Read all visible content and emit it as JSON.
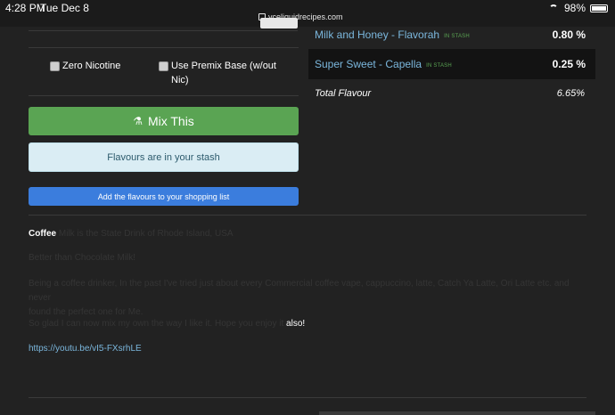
{
  "status": {
    "time": "4:28 PM",
    "date": "Tue Dec 8",
    "url": "vceliquidrecipes.com",
    "battery": "98%",
    "battery_level": 0.98
  },
  "options": {
    "zero_nicotine": "Zero Nicotine",
    "premix_base_line1": "Use Premix Base (w/out",
    "premix_base_line2": "Nic)"
  },
  "buttons": {
    "mix": "Mix This",
    "stash_alert": "Flavours are in your stash",
    "shopping": "Add the flavours to your shopping list"
  },
  "flavours": [
    {
      "name": "Milk and Honey - Flavorah",
      "tag": "IN STASH",
      "pct": "0.80 %"
    },
    {
      "name": "Super Sweet - Capella",
      "tag": "IN STASH",
      "pct": "0.25 %"
    }
  ],
  "total": {
    "label": "Total Flavour",
    "value": "6.65%"
  },
  "description": {
    "coffee": "Coffee",
    "line1": "Milk is the State Drink of Rhode Island, USA",
    "line2": "Better than Chocolate Milk!",
    "line3a": "Being a coffee drinker, In the past I've tried just about every Commercial coffee vape, cappuccino, latte, Catch Ya Latte, Ori Latte etc. and never",
    "line3b": "found the perfect one for Me.",
    "line4": "So glad I can now mix my own the way I like it. Hope you enjoy it",
    "line4_end": "also!",
    "link": "https://youtu.be/vI5-FXsrhLE"
  },
  "icons": {
    "flask": "flask-icon",
    "wifi": "wifi-icon",
    "battery": "battery-icon",
    "lock": "lock-icon"
  }
}
